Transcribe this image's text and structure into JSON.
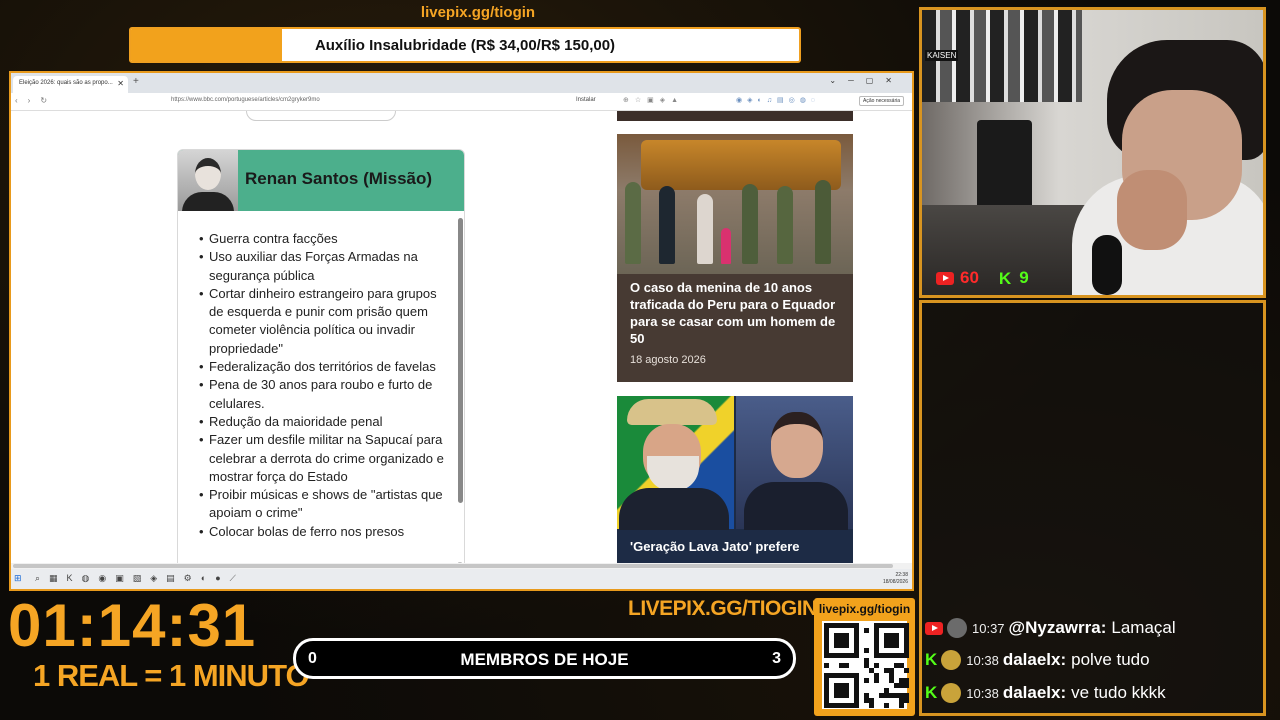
{
  "stream": {
    "goal_url": "livepix.gg/tiogin",
    "goal_text": "Auxílio Insalubridade (R$ 34,00/R$ 150,00)",
    "goal_progress": 0.2267,
    "accent_color": "#f5a524",
    "timer": "01:14:31",
    "rate": "1 REAL = 1 MINUTO",
    "livepix_big": "LIVEPIX.GG/TIOGIN",
    "qr_label": "livepix.gg/tiogin",
    "members": {
      "left": "0",
      "label": "MEMBROS DE HOJE",
      "right": "3"
    },
    "viewers": {
      "youtube": "60",
      "kick": "9"
    }
  },
  "browser": {
    "tab_title": "Eleição 2026: quais são as propo...",
    "url": "https://www.bbc.com/portuguese/articles/cm2gryker9mo",
    "install_label": "Instalar",
    "action_label": "Ação necessária",
    "clock": "22:38",
    "date": "18/08/2026"
  },
  "card": {
    "title": "Renan Santos (Missão)",
    "header_color": "#4caf8c",
    "items": [
      "Guerra contra facções",
      "Uso auxiliar das Forças Armadas na segurança pública",
      "Cortar dinheiro estrangeiro para grupos de esquerda e punir com prisão quem cometer violência política ou invadir propriedade\"",
      "Federalização dos territórios de favelas",
      "Pena de 30 anos para roubo e furto de celulares.",
      "Redução da maioridade penal",
      "Fazer um desfile militar na Sapucaí para celebrar a derrota do crime organizado e mostrar força do Estado",
      "Proibir músicas e shows de \"artistas que apoiam o crime\"",
      "Colocar bolas de ferro nos presos"
    ]
  },
  "news": [
    {
      "title": "O caso da menina de 10 anos traficada do Peru para o Equador para se casar com um homem de 50",
      "date": "18 agosto 2026"
    },
    {
      "title": "'Geração Lava Jato' prefere"
    }
  ],
  "chat": [
    {
      "source": "youtube",
      "time": "10:37",
      "user": "@Nyzawrra:",
      "text": "Lamaçal",
      "avatar_color": "#6b6b6b"
    },
    {
      "source": "kick",
      "time": "10:38",
      "user": "dalaelx:",
      "text": "polve tudo",
      "avatar_color": "#c9a33a"
    },
    {
      "source": "kick",
      "time": "10:38",
      "user": "dalaelx:",
      "text": "ve tudo kkkk",
      "avatar_color": "#c9a33a"
    }
  ]
}
